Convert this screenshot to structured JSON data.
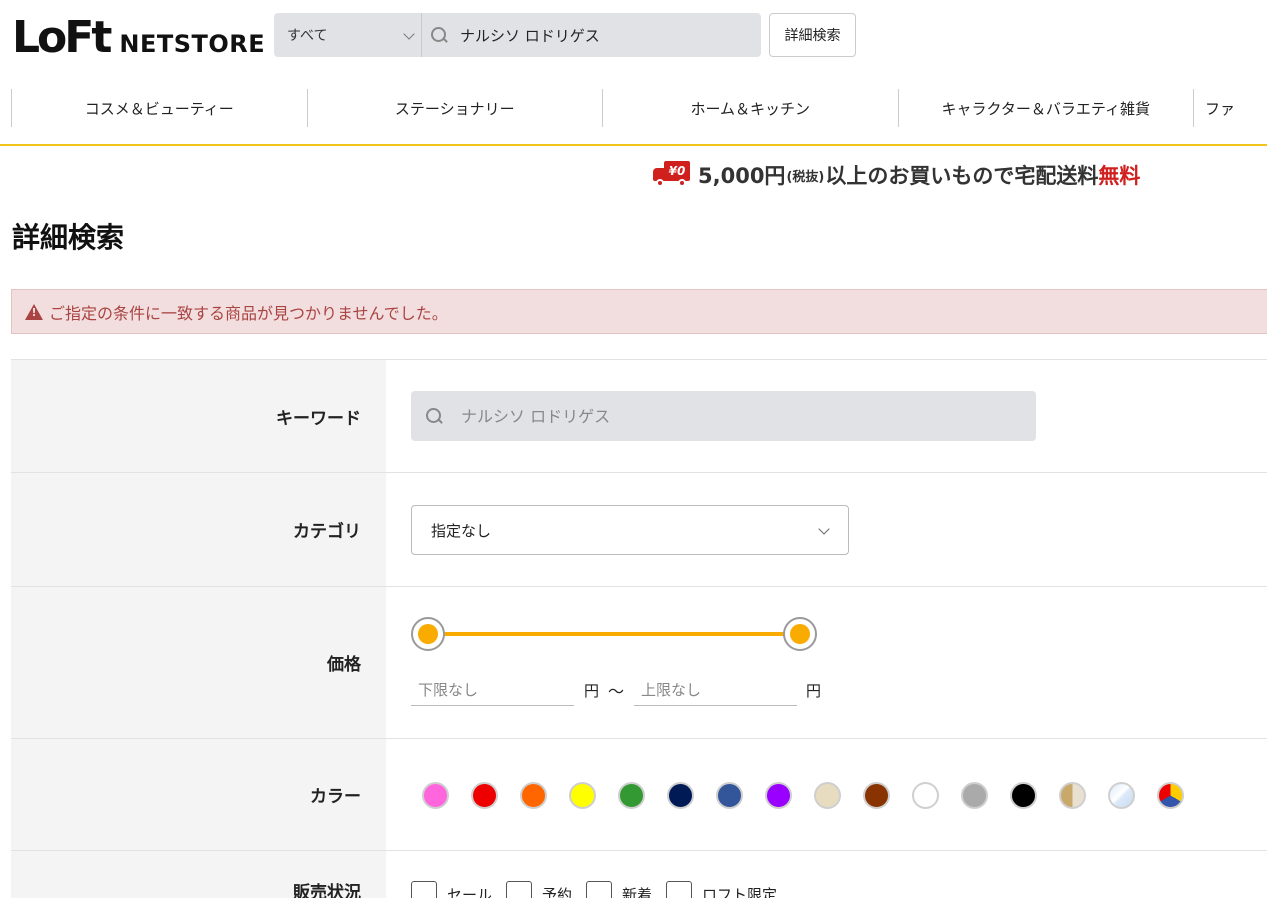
{
  "header": {
    "logo_loft": "LoFt",
    "logo_netstore": "NETSTORE",
    "search_scope": "すべて",
    "search_value": "ナルシソ ロドリゲス",
    "advanced_search_label": "詳細検索"
  },
  "nav": {
    "items": [
      "コスメ＆ビューティー",
      "ステーショナリー",
      "ホーム＆キッチン",
      "キャラクター＆バラエティ雑貨",
      "ファ"
    ]
  },
  "shipping_banner": {
    "badge": "¥0",
    "amount": "5,000円",
    "tax": "(税抜)",
    "text": "以上のお買いもので宅配送料",
    "free": "無料"
  },
  "page_title": "詳細検索",
  "alert": {
    "message": "ご指定の条件に一致する商品が見つかりませんでした。"
  },
  "form": {
    "keyword": {
      "label": "キーワード",
      "placeholder": "ナルシソ ロドリゲス"
    },
    "category": {
      "label": "カテゴリ",
      "selected": "指定なし"
    },
    "price": {
      "label": "価格",
      "min_placeholder": "下限なし",
      "max_placeholder": "上限なし",
      "unit": "円",
      "separator": "〜",
      "slider_accent": "#f9ab00"
    },
    "color": {
      "label": "カラー",
      "swatches": [
        {
          "name": "pink",
          "fill": "#ff66dd"
        },
        {
          "name": "red",
          "fill": "#ee0000"
        },
        {
          "name": "orange",
          "fill": "#ff6600"
        },
        {
          "name": "yellow",
          "fill": "#ffff00"
        },
        {
          "name": "green",
          "fill": "#339933"
        },
        {
          "name": "navy",
          "fill": "#001a55"
        },
        {
          "name": "blue",
          "fill": "#335599"
        },
        {
          "name": "purple",
          "fill": "#9900ff"
        },
        {
          "name": "beige",
          "fill": "#e8dcc0"
        },
        {
          "name": "brown",
          "fill": "#883300"
        },
        {
          "name": "white",
          "fill": "#ffffff"
        },
        {
          "name": "gray",
          "fill": "#aaaaaa"
        },
        {
          "name": "black",
          "fill": "#000000"
        },
        {
          "name": "gold",
          "fill": "linear-gradient(90deg,#c8a96a 50%,#e8e0d0 50%)"
        },
        {
          "name": "silver-clear",
          "fill": "linear-gradient(135deg,#dbe9f9 0%,#ffffff 45%,#dbe9f9 55%,#c9dcf3 100%)"
        },
        {
          "name": "multi",
          "fill": "conic-gradient(#ffcc00 0deg 120deg,#3355aa 120deg 240deg,#ee0000 240deg 360deg)"
        }
      ]
    },
    "sale_status": {
      "label": "販売状況",
      "options": [
        "セール",
        "予約",
        "新着",
        "ロフト限定"
      ]
    }
  }
}
